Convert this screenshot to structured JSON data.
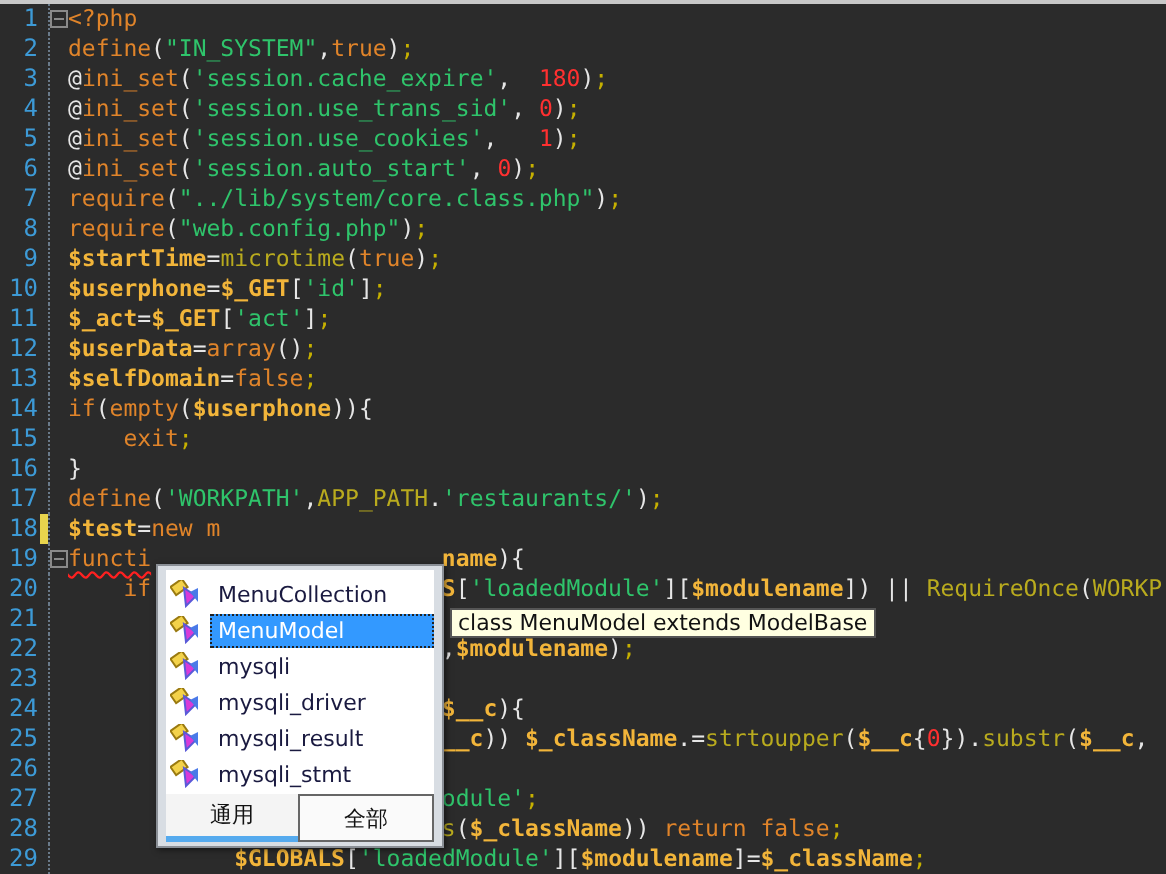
{
  "editor": {
    "lines": [
      {
        "number": "1",
        "fold": true,
        "changed": false,
        "tokens": [
          {
            "kind": "kw",
            "text": "<?php"
          }
        ]
      },
      {
        "number": "2",
        "fold": false,
        "changed": false,
        "tokens": [
          {
            "kind": "kw",
            "text": "define"
          },
          {
            "kind": "p",
            "text": "("
          },
          {
            "kind": "str",
            "text": "\"IN_SYSTEM\""
          },
          {
            "kind": "p",
            "text": ","
          },
          {
            "kind": "kw",
            "text": "true"
          },
          {
            "kind": "p",
            "text": ")"
          },
          {
            "kind": "semi",
            "text": ";"
          }
        ]
      },
      {
        "number": "3",
        "fold": false,
        "changed": false,
        "tokens": [
          {
            "kind": "p",
            "text": "@"
          },
          {
            "kind": "kw",
            "text": "ini_set"
          },
          {
            "kind": "p",
            "text": "("
          },
          {
            "kind": "str",
            "text": "'session.cache_expire'"
          },
          {
            "kind": "p",
            "text": ",  "
          },
          {
            "kind": "num",
            "text": "180"
          },
          {
            "kind": "p",
            "text": ")"
          },
          {
            "kind": "semi",
            "text": ";"
          }
        ]
      },
      {
        "number": "4",
        "fold": false,
        "changed": false,
        "tokens": [
          {
            "kind": "p",
            "text": "@"
          },
          {
            "kind": "kw",
            "text": "ini_set"
          },
          {
            "kind": "p",
            "text": "("
          },
          {
            "kind": "str",
            "text": "'session.use_trans_sid'"
          },
          {
            "kind": "p",
            "text": ", "
          },
          {
            "kind": "num",
            "text": "0"
          },
          {
            "kind": "p",
            "text": ")"
          },
          {
            "kind": "semi",
            "text": ";"
          }
        ]
      },
      {
        "number": "5",
        "fold": false,
        "changed": false,
        "tokens": [
          {
            "kind": "p",
            "text": "@"
          },
          {
            "kind": "kw",
            "text": "ini_set"
          },
          {
            "kind": "p",
            "text": "("
          },
          {
            "kind": "str",
            "text": "'session.use_cookies'"
          },
          {
            "kind": "p",
            "text": ",   "
          },
          {
            "kind": "num",
            "text": "1"
          },
          {
            "kind": "p",
            "text": ")"
          },
          {
            "kind": "semi",
            "text": ";"
          }
        ]
      },
      {
        "number": "6",
        "fold": false,
        "changed": false,
        "tokens": [
          {
            "kind": "p",
            "text": "@"
          },
          {
            "kind": "kw",
            "text": "ini_set"
          },
          {
            "kind": "p",
            "text": "("
          },
          {
            "kind": "str",
            "text": "'session.auto_start'"
          },
          {
            "kind": "p",
            "text": ", "
          },
          {
            "kind": "num",
            "text": "0"
          },
          {
            "kind": "p",
            "text": ")"
          },
          {
            "kind": "semi",
            "text": ";"
          }
        ]
      },
      {
        "number": "7",
        "fold": false,
        "changed": false,
        "tokens": [
          {
            "kind": "kw",
            "text": "require"
          },
          {
            "kind": "p",
            "text": "("
          },
          {
            "kind": "str",
            "text": "\"../lib/system/core.class.php\""
          },
          {
            "kind": "p",
            "text": ")"
          },
          {
            "kind": "semi",
            "text": ";"
          }
        ]
      },
      {
        "number": "8",
        "fold": false,
        "changed": false,
        "tokens": [
          {
            "kind": "kw",
            "text": "require"
          },
          {
            "kind": "p",
            "text": "("
          },
          {
            "kind": "str",
            "text": "\"web.config.php\""
          },
          {
            "kind": "p",
            "text": ")"
          },
          {
            "kind": "semi",
            "text": ";"
          }
        ]
      },
      {
        "number": "9",
        "fold": false,
        "changed": false,
        "tokens": [
          {
            "kind": "var",
            "text": "$startTime"
          },
          {
            "kind": "p",
            "text": "="
          },
          {
            "kind": "fn",
            "text": "microtime"
          },
          {
            "kind": "p",
            "text": "("
          },
          {
            "kind": "kw",
            "text": "true"
          },
          {
            "kind": "p",
            "text": ")"
          },
          {
            "kind": "semi",
            "text": ";"
          }
        ]
      },
      {
        "number": "10",
        "fold": false,
        "changed": false,
        "tokens": [
          {
            "kind": "var",
            "text": "$userphone"
          },
          {
            "kind": "p",
            "text": "="
          },
          {
            "kind": "var",
            "text": "$_GET"
          },
          {
            "kind": "p",
            "text": "["
          },
          {
            "kind": "str",
            "text": "'id'"
          },
          {
            "kind": "p",
            "text": "]"
          },
          {
            "kind": "semi",
            "text": ";"
          }
        ]
      },
      {
        "number": "11",
        "fold": false,
        "changed": false,
        "tokens": [
          {
            "kind": "var",
            "text": "$_act"
          },
          {
            "kind": "p",
            "text": "="
          },
          {
            "kind": "var",
            "text": "$_GET"
          },
          {
            "kind": "p",
            "text": "["
          },
          {
            "kind": "str",
            "text": "'act'"
          },
          {
            "kind": "p",
            "text": "]"
          },
          {
            "kind": "semi",
            "text": ";"
          }
        ]
      },
      {
        "number": "12",
        "fold": false,
        "changed": false,
        "tokens": [
          {
            "kind": "var",
            "text": "$userData"
          },
          {
            "kind": "p",
            "text": "="
          },
          {
            "kind": "kw",
            "text": "array"
          },
          {
            "kind": "p",
            "text": "()"
          },
          {
            "kind": "semi",
            "text": ";"
          }
        ]
      },
      {
        "number": "13",
        "fold": false,
        "changed": false,
        "tokens": [
          {
            "kind": "var",
            "text": "$selfDomain"
          },
          {
            "kind": "p",
            "text": "="
          },
          {
            "kind": "kw",
            "text": "false"
          },
          {
            "kind": "semi",
            "text": ";"
          }
        ]
      },
      {
        "number": "14",
        "fold": false,
        "changed": false,
        "tokens": [
          {
            "kind": "kw",
            "text": "if"
          },
          {
            "kind": "p",
            "text": "("
          },
          {
            "kind": "kw",
            "text": "empty"
          },
          {
            "kind": "p",
            "text": "("
          },
          {
            "kind": "var",
            "text": "$userphone"
          },
          {
            "kind": "p",
            "text": ")){"
          }
        ]
      },
      {
        "number": "15",
        "fold": false,
        "changed": false,
        "tokens": [
          {
            "kind": "kw",
            "text": "    exit"
          },
          {
            "kind": "semi",
            "text": ";"
          }
        ]
      },
      {
        "number": "16",
        "fold": false,
        "changed": false,
        "tokens": [
          {
            "kind": "p",
            "text": "}"
          }
        ]
      },
      {
        "number": "17",
        "fold": false,
        "changed": false,
        "tokens": [
          {
            "kind": "kw",
            "text": "define"
          },
          {
            "kind": "p",
            "text": "("
          },
          {
            "kind": "str",
            "text": "'WORKPATH'"
          },
          {
            "kind": "p",
            "text": ","
          },
          {
            "kind": "fn",
            "text": "APP_PATH"
          },
          {
            "kind": "p",
            "text": "."
          },
          {
            "kind": "str",
            "text": "'restaurants/'"
          },
          {
            "kind": "p",
            "text": ")"
          },
          {
            "kind": "semi",
            "text": ";"
          }
        ]
      },
      {
        "number": "18",
        "fold": false,
        "changed": true,
        "tokens": [
          {
            "kind": "var",
            "text": "$test"
          },
          {
            "kind": "p",
            "text": "="
          },
          {
            "kind": "kw",
            "text": "new m"
          }
        ]
      },
      {
        "number": "19",
        "fold": true,
        "changed": false,
        "tokens": [
          {
            "kind": "kw",
            "text": "functi",
            "error": true
          }
        ],
        "right": [
          {
            "kind": "var",
            "text": "name"
          },
          {
            "kind": "p",
            "text": "){"
          }
        ]
      },
      {
        "number": "20",
        "fold": false,
        "changed": false,
        "tokens": [
          {
            "kind": "kw",
            "text": "    if"
          }
        ],
        "right": [
          {
            "kind": "var",
            "text": "S"
          },
          {
            "kind": "p",
            "text": "["
          },
          {
            "kind": "str",
            "text": "'loadedModule'"
          },
          {
            "kind": "p",
            "text": "]["
          },
          {
            "kind": "var",
            "text": "$modulename"
          },
          {
            "kind": "p",
            "text": "]) || "
          },
          {
            "kind": "fn",
            "text": "RequireOnce"
          },
          {
            "kind": "p",
            "text": "("
          },
          {
            "kind": "fn",
            "text": "WORKP"
          }
        ]
      },
      {
        "number": "21",
        "fold": false,
        "changed": false
      },
      {
        "number": "22",
        "fold": false,
        "changed": false,
        "right": [
          {
            "kind": "p",
            "text": ","
          },
          {
            "kind": "var",
            "text": "$modulename"
          },
          {
            "kind": "p",
            "text": ")"
          },
          {
            "kind": "semi",
            "text": ";"
          }
        ]
      },
      {
        "number": "23",
        "fold": false,
        "changed": false
      },
      {
        "number": "24",
        "fold": false,
        "changed": false,
        "right": [
          {
            "kind": "var",
            "text": "$__c"
          },
          {
            "kind": "p",
            "text": "){"
          }
        ]
      },
      {
        "number": "25",
        "fold": false,
        "changed": false,
        "right": [
          {
            "kind": "var",
            "text": "__c"
          },
          {
            "kind": "p",
            "text": ")) "
          },
          {
            "kind": "var",
            "text": "$_className"
          },
          {
            "kind": "p",
            "text": ".="
          },
          {
            "kind": "fn",
            "text": "strtoupper"
          },
          {
            "kind": "p",
            "text": "("
          },
          {
            "kind": "var",
            "text": "$__c"
          },
          {
            "kind": "p",
            "text": "{"
          },
          {
            "kind": "num",
            "text": "0"
          },
          {
            "kind": "p",
            "text": "})."
          },
          {
            "kind": "fn",
            "text": "substr"
          },
          {
            "kind": "p",
            "text": "("
          },
          {
            "kind": "var",
            "text": "$__c"
          },
          {
            "kind": "p",
            "text": ","
          }
        ]
      },
      {
        "number": "26",
        "fold": false,
        "changed": false
      },
      {
        "number": "27",
        "fold": false,
        "changed": false,
        "right": [
          {
            "kind": "str",
            "text": "odule'"
          },
          {
            "kind": "semi",
            "text": ";"
          }
        ]
      },
      {
        "number": "28",
        "fold": false,
        "changed": false,
        "right": [
          {
            "kind": "fn",
            "text": "s"
          },
          {
            "kind": "p",
            "text": "("
          },
          {
            "kind": "var",
            "text": "$_className"
          },
          {
            "kind": "p",
            "text": ")) "
          },
          {
            "kind": "kw",
            "text": "return false"
          },
          {
            "kind": "semi",
            "text": ";"
          }
        ]
      },
      {
        "number": "29",
        "fold": false,
        "changed": false,
        "tokens": [
          {
            "kind": "var",
            "text": "            $GLOBALS"
          },
          {
            "kind": "p",
            "text": "["
          },
          {
            "kind": "str",
            "text": "'loadedModule'"
          },
          {
            "kind": "p",
            "text": "]["
          },
          {
            "kind": "var",
            "text": "$modulename"
          },
          {
            "kind": "p",
            "text": "]="
          },
          {
            "kind": "var",
            "text": "$_className"
          },
          {
            "kind": "semi",
            "text": ";"
          }
        ]
      }
    ]
  },
  "autocomplete": {
    "items": [
      {
        "label": "MenuCollection",
        "selected": false
      },
      {
        "label": "MenuModel",
        "selected": true
      },
      {
        "label": "mysqli",
        "selected": false
      },
      {
        "label": "mysqli_driver",
        "selected": false
      },
      {
        "label": "mysqli_result",
        "selected": false
      },
      {
        "label": "mysqli_stmt",
        "selected": false
      }
    ],
    "tabs": [
      {
        "label": "通用",
        "selected": true
      },
      {
        "label": "全部",
        "selected": false
      }
    ],
    "tooltip": "class MenuModel extends ModelBase"
  }
}
